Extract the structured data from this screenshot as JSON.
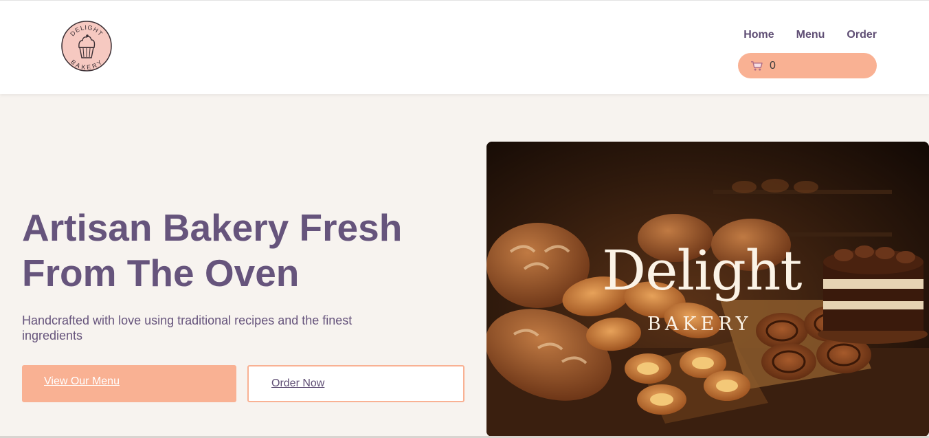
{
  "brand": {
    "logo_top_text": "DELIGHT",
    "logo_bottom_text": "BAKERY"
  },
  "nav": {
    "items": [
      {
        "label": "Home"
      },
      {
        "label": "Menu"
      },
      {
        "label": "Order"
      }
    ]
  },
  "cart": {
    "count": "0",
    "icon": "cart-icon"
  },
  "hero": {
    "title": "Artisan Bakery Fresh From The Oven",
    "subtitle": "Handcrafted with love using traditional recipes and the finest ingredients",
    "primary_button": "View Our Menu",
    "secondary_button": "Order Now"
  },
  "hero_image": {
    "title": "Delight",
    "subtitle": "BAKERY"
  },
  "colors": {
    "accent": "#f9b193",
    "heading": "#66547c",
    "background": "#f7f3ef",
    "logo_fill": "#f6c9c1"
  }
}
